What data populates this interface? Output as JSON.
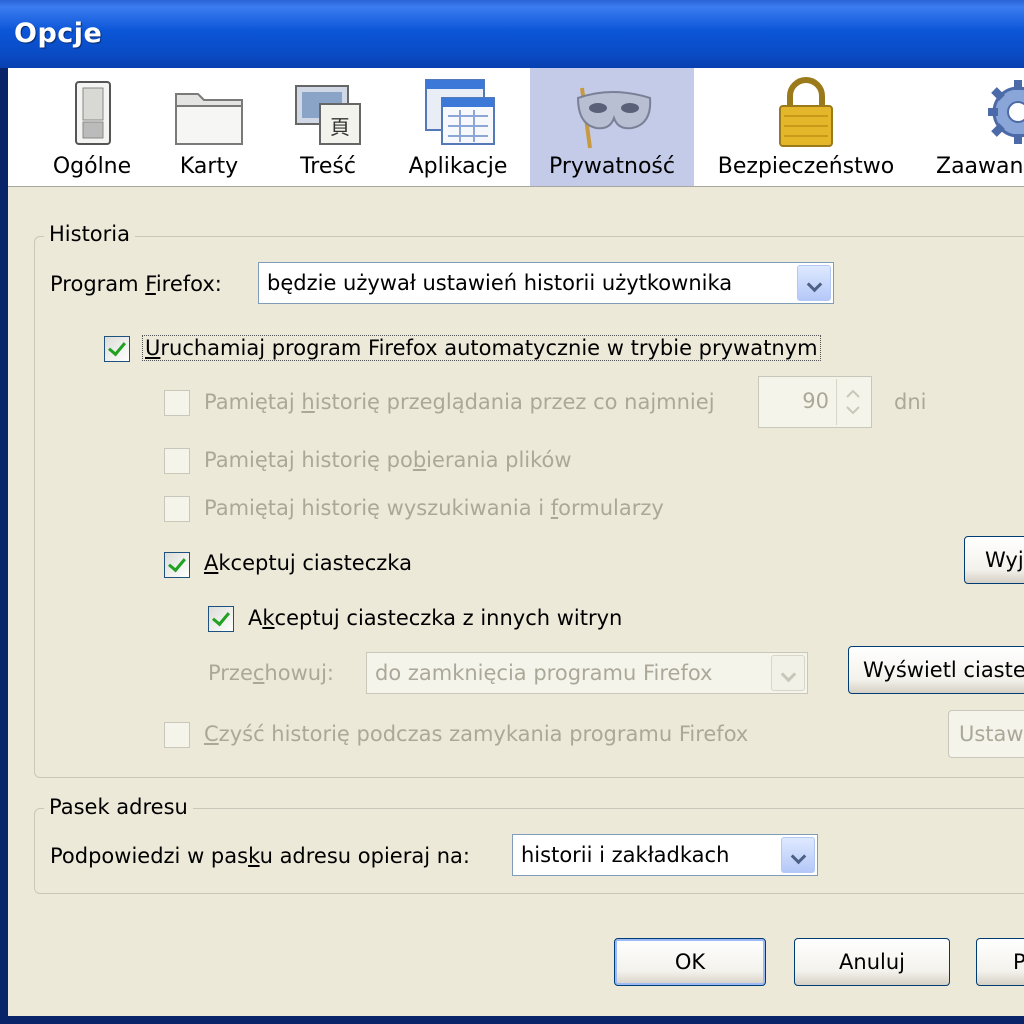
{
  "window": {
    "title": "Opcje"
  },
  "tabs": [
    {
      "label": "Ogólne",
      "icon": "general-switch-icon"
    },
    {
      "label": "Karty",
      "icon": "tabs-folder-icon"
    },
    {
      "label": "Treść",
      "icon": "content-icon"
    },
    {
      "label": "Aplikacje",
      "icon": "applications-icon"
    },
    {
      "label": "Prywatność",
      "icon": "privacy-mask-icon",
      "active": true
    },
    {
      "label": "Bezpieczeństwo",
      "icon": "security-lock-icon"
    },
    {
      "label": "Zaawan",
      "icon": "advanced-gear-icon"
    }
  ],
  "history": {
    "group_label": "Historia",
    "program_label_pre": "Program ",
    "program_label_u": "F",
    "program_label_post": "irefox:",
    "program_value": "będzie używał ustawień historii użytkownika",
    "private_mode": {
      "pre": "",
      "u": "U",
      "post": "ruchamiaj program Firefox automatycznie w trybie prywatnym",
      "checked": true
    },
    "remember_browsing": {
      "pre": "Pamiętaj ",
      "u": "h",
      "post": "istorię przeglądania przez co najmniej",
      "checked": false
    },
    "days_value": "90",
    "days_unit": "dni",
    "remember_downloads": {
      "pre": "Pamiętaj historię po",
      "u": "b",
      "post": "ierania plików",
      "checked": false
    },
    "remember_forms": {
      "pre": "Pamiętaj historię wyszukiwania i ",
      "u": "f",
      "post": "ormularzy",
      "checked": false
    },
    "accept_cookies": {
      "pre": "",
      "u": "A",
      "post": "kceptuj ciasteczka",
      "checked": true
    },
    "exceptions_button": "Wyj",
    "accept_third_party": {
      "pre": "A",
      "u": "k",
      "post": "ceptuj ciasteczka z innych witryn",
      "checked": true
    },
    "keep_label_pre": "Prze",
    "keep_label_u": "c",
    "keep_label_post": "howuj:",
    "keep_value": "do zamknięcia programu Firefox",
    "show_cookies_button": "Wyświetl ciaste",
    "clear_history": {
      "pre": "",
      "u": "C",
      "post": "zyść historię podczas zamykania programu Firefox",
      "checked": false
    },
    "settings_button": "Ustaw"
  },
  "address_bar": {
    "group_label": "Pasek adresu",
    "label_pre": "Podpowiedzi w pas",
    "label_u": "k",
    "label_post": "u adresu opieraj na:",
    "value": "historii i zakładkach"
  },
  "buttons": {
    "ok": "OK",
    "cancel": "Anuluj",
    "help": "P"
  },
  "colors": {
    "titlebar": "#0b56d8",
    "dialog_bg": "#ece9d8",
    "active_tab": "#c4cbe8",
    "check": "#21a121"
  }
}
